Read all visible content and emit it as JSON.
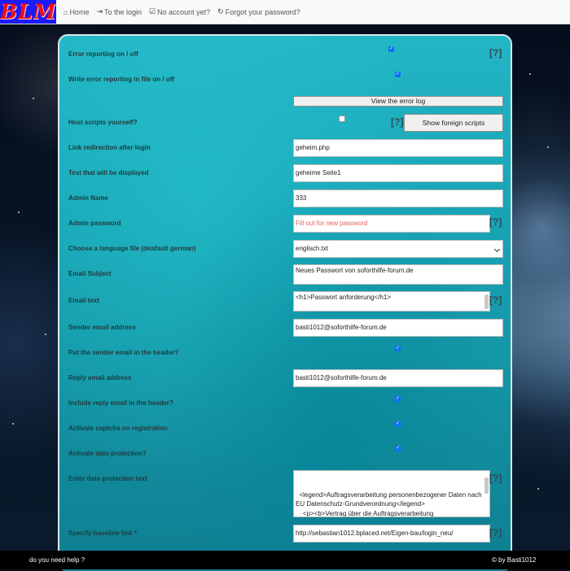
{
  "nav": {
    "logo": "BLM",
    "items": [
      {
        "label": "Home",
        "icon": "home-icon",
        "glyph": "⌂"
      },
      {
        "label": "To the login",
        "icon": "sign-in-icon",
        "glyph": "⇥"
      },
      {
        "label": "No account yet?",
        "icon": "check-square-icon",
        "glyph": "☑"
      },
      {
        "label": "Forgot your password?",
        "icon": "sign-out-icon",
        "glyph": "↻"
      }
    ]
  },
  "form": {
    "help_mark": "[?]",
    "error_reporting": {
      "label": "Error reporting on / off",
      "checked": true
    },
    "write_error_file": {
      "label": "Write error reporting in file on / off",
      "checked": true
    },
    "view_error_log_button": "View the error log",
    "host_scripts": {
      "label": "Host scripts yourself?",
      "checked": false,
      "button": "Show foreign scripts"
    },
    "link_redirect": {
      "label": "Link redirection after login",
      "value": "geheim.php"
    },
    "display_text": {
      "label": "Text that will be displayed",
      "value": "geheime Seite1"
    },
    "admin_name": {
      "label": "Admin Name",
      "value": "333"
    },
    "admin_password": {
      "label": "Admin password",
      "placeholder": "Fill out for new password"
    },
    "language_file": {
      "label": "Choose a language file (deafault german)",
      "value": "englisch.txt"
    },
    "email_subject": {
      "label": "Email Subject",
      "value": "Neues Passwort von soforthilfe-forum.de"
    },
    "email_text": {
      "label": "Email text",
      "value": "<h1>Passwort anforderung</h1>"
    },
    "sender_email": {
      "label": "Sender email address",
      "value": "basti1012@soforthilfe-forum.de"
    },
    "sender_in_header": {
      "label": "Put the sender email in the header?",
      "checked": true
    },
    "reply_email": {
      "label": "Reply email address",
      "value": "basti1012@soforthilfe-forum.de"
    },
    "reply_in_header": {
      "label": "Include reply email in the header?",
      "checked": true
    },
    "captcha": {
      "label": "Activate captcha on registration",
      "checked": true
    },
    "data_protection": {
      "label": "Activate data protection?",
      "checked": true
    },
    "data_protection_text": {
      "label": "Enter data protection text",
      "value": "<legend>Auftragsverarbeitung personenbezogener Daten nach EU Datenschutz-Grundverordnung</legend>\n    <p><b>Vertrag über die Auftragsverarbeitung personenbezogener Daten nach EU Datenschutz-"
    },
    "baseline_link": {
      "label": "Specify baseline link *",
      "value": "http://sebastian1012.bplaced.net/Eigen-bau/login_neu/"
    }
  },
  "footer": {
    "help_text": "do you need help ?",
    "credit": "© by Basti1012"
  },
  "colors": {
    "accent": "#0d6efd",
    "panel": "#1aa9ba",
    "logo_bg": "#1a1aff",
    "logo_text": "#e8101a"
  }
}
